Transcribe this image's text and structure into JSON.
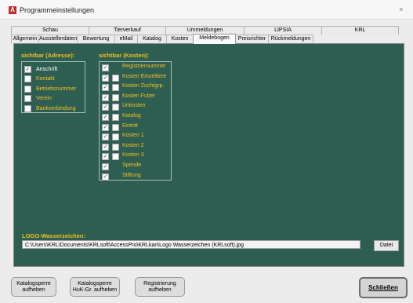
{
  "window": {
    "title": "Programmeinstellungen",
    "close_icon": "×"
  },
  "tabs_row1": [
    "Schau",
    "Tierverkauf",
    "Ummeldungen",
    "LIPSIA",
    "KRL"
  ],
  "tabs_row2": [
    "Allgemein",
    "Ausstellerdaten",
    "Bewertung",
    "eMail",
    "Katalog",
    "Kosten",
    "Meldebogen",
    "Preisrichter",
    "Rückmeldungen"
  ],
  "active_tab": "Meldebogen",
  "address": {
    "header": "sichtbar (Adresse):",
    "items": [
      {
        "label": "Anschrift",
        "checked": true
      },
      {
        "label": "Kontakt",
        "checked": false
      },
      {
        "label": "Betriebsnummer",
        "checked": false
      },
      {
        "label": "Verein",
        "checked": false
      },
      {
        "label": "Bankverbindung",
        "checked": false
      }
    ]
  },
  "costs": {
    "header": "sichtbar (Kosten):",
    "items": [
      {
        "label": "Registriernummer",
        "col1": true,
        "col2": null
      },
      {
        "label": "Kosten Einzeltiere",
        "col1": true,
        "col2": false
      },
      {
        "label": "Kosten Zuchtgrp.",
        "col1": true,
        "col2": false
      },
      {
        "label": "Kosten Futter",
        "col1": true,
        "col2": false
      },
      {
        "label": "Unkosten",
        "col1": true,
        "col2": false
      },
      {
        "label": "Katalog",
        "col1": true,
        "col2": false
      },
      {
        "label": "Eintritt",
        "col1": true,
        "col2": false
      },
      {
        "label": "Kosten 1",
        "col1": true,
        "col2": false
      },
      {
        "label": "Kosten 2",
        "col1": true,
        "col2": false
      },
      {
        "label": "Kosten 3",
        "col1": true,
        "col2": false
      },
      {
        "label": "Spende",
        "col1": true,
        "col2": null
      },
      {
        "label": "Stiftung",
        "col1": true,
        "col2": null
      }
    ]
  },
  "logo": {
    "header": "LOGO-Wasserzeichen:",
    "path": "C:\\Users\\KRL\\Documents\\KRLsoft\\AccessPro\\KRLkan\\Logo Wasserzeichen (KRLsoft).jpg",
    "button": "Datei"
  },
  "footer": {
    "btn1": "Katalogsperre\naufheben",
    "btn2": "Katalogsperre\nHuK-Gr. aufheben",
    "btn3": "Registrierung\naufheben",
    "close": "Schließen"
  }
}
